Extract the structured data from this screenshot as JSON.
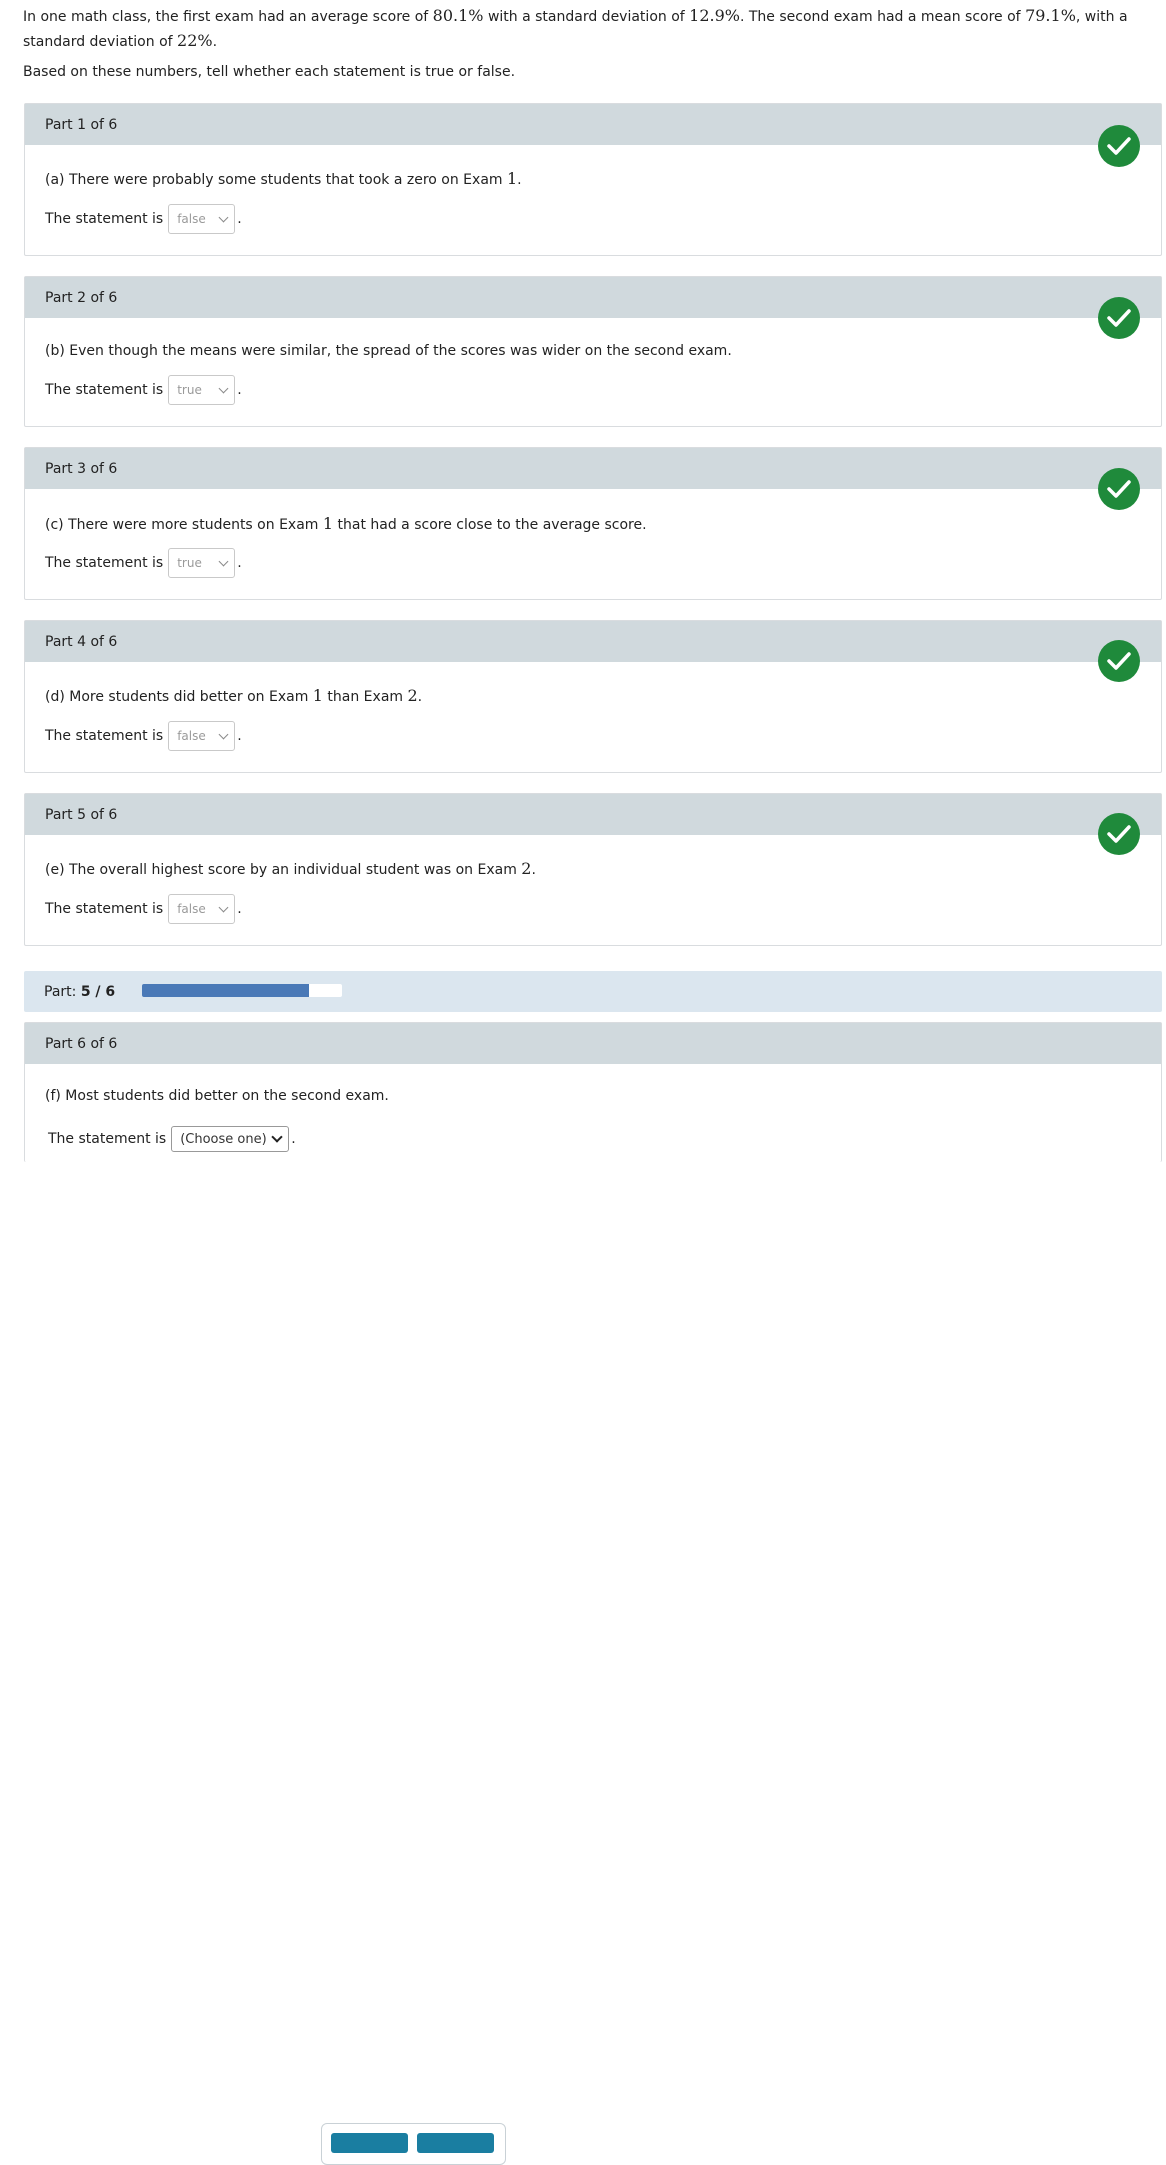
{
  "intro": {
    "t1": "In one math class, the first exam had an average score of ",
    "v1": "80.1%",
    "t2": " with a standard deviation of ",
    "v2": "12.9%",
    "t3": ". The second exam had a mean score of ",
    "v3": "79.1%",
    "t4": ", with a standard deviation of ",
    "v4": "22%",
    "t5": "."
  },
  "instruction": "Based on these numbers, tell whether each statement is true or false.",
  "statement_prefix": "The statement is",
  "parts": [
    {
      "title": "Part 1 of 6",
      "q_text": "(a) There were probably some students that took a zero on Exam ",
      "q_math": "1",
      "q_end": ".",
      "answer": "false",
      "correct": true
    },
    {
      "title": "Part 2 of 6",
      "q_text": "(b) Even though the means were similar, the spread of the scores was wider on the second exam.",
      "q_math": "",
      "q_end": "",
      "answer": "true",
      "correct": true
    },
    {
      "title": "Part 3 of 6",
      "q_text": "(c) There were more students on Exam ",
      "q_math": "1",
      "q_end": " that had a score close to the average score.",
      "answer": "true",
      "correct": true
    },
    {
      "title": "Part 4 of 6",
      "q_text": "(d) More students did better on Exam ",
      "q_math": "1",
      "q_mid": " than Exam ",
      "q_math2": "2",
      "q_end": ".",
      "answer": "false",
      "correct": true
    },
    {
      "title": "Part 5 of 6",
      "q_text": "(e) The overall highest score by an individual student was on Exam ",
      "q_math": "2",
      "q_end": ".",
      "answer": "false",
      "correct": true
    }
  ],
  "progress": {
    "label": "Part:",
    "value_text": "5 / 6",
    "fraction": 0.8333
  },
  "part6": {
    "title": "Part 6 of 6",
    "question": "(f) Most students did better on the second exam.",
    "select_placeholder": "(Choose one)"
  },
  "icons": {
    "check": "check-circle-icon",
    "chevron": "chevron-down-icon"
  },
  "colors": {
    "header_bg": "#d0d9dd",
    "progress_bg": "#dbe6ef",
    "progress_fill": "#4a79b7",
    "check_green": "#1f8a3b",
    "button": "#1a7ea1"
  }
}
